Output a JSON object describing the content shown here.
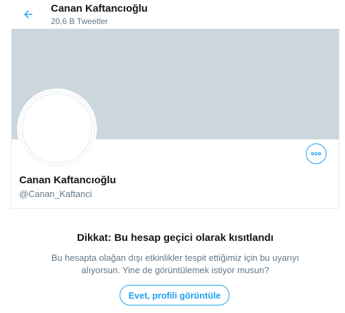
{
  "header": {
    "back_icon": "arrow-left-icon",
    "name": "Canan Kaftancıoğlu",
    "tweet_count": "20,6 B Tweetler"
  },
  "profile": {
    "name": "Canan Kaftancıoğlu",
    "handle": "@Canan_Kaftanci",
    "more_icon": "more-horizontal-icon"
  },
  "notice": {
    "title": "Dikkat: Bu hesap geçici olarak kısıtlandı",
    "text": "Bu hesapta olağan dışı etkinlikler tespit ettiğimiz için bu uyarıyı alıyorsun. Yine de görüntülemek istiyor musun?",
    "button_label": "Evet, profili görüntüle"
  },
  "colors": {
    "accent": "#1da1f2",
    "banner": "#ccd6dd",
    "secondary_text": "#657786"
  }
}
